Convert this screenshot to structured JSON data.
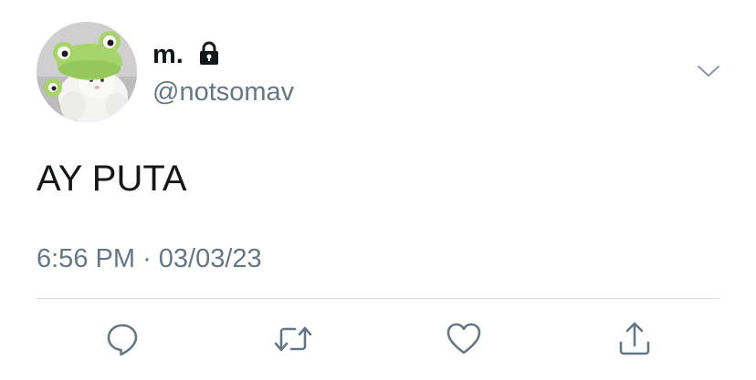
{
  "author": {
    "display_name": "m.",
    "handle": "@notsomav",
    "protected_icon": "lock-icon",
    "avatar": "frog-hat-plush-avatar"
  },
  "tweet": {
    "text": "AY PUTA",
    "time": "6:56 PM",
    "separator": "·",
    "date": "03/03/23"
  },
  "actions": [
    {
      "icon": "reply-icon"
    },
    {
      "icon": "retweet-icon"
    },
    {
      "icon": "like-icon"
    },
    {
      "icon": "share-icon"
    }
  ],
  "colors": {
    "text": "#14171a",
    "secondary_text": "#657786",
    "icon": "#657786",
    "divider": "#d8dde2",
    "background": "#ffffff"
  }
}
